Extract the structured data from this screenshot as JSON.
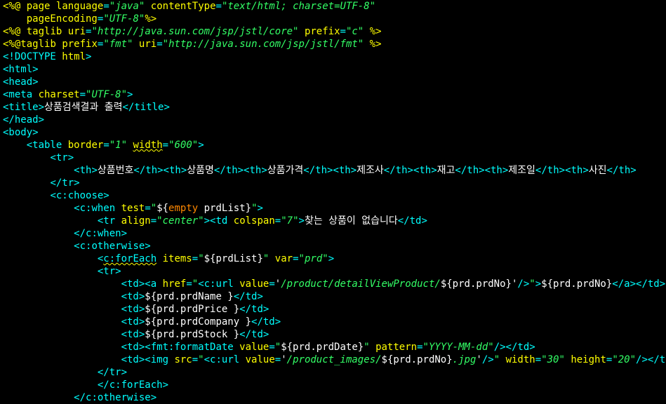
{
  "editor": {
    "colors": {
      "background": "#000000",
      "jsp_delimiter": "#ffff00",
      "tag": "#00ffff",
      "attribute": "#ffff00",
      "string": "#33ff66",
      "keyword": "#ff8800",
      "text": "#ffffff"
    },
    "lines": [
      [
        [
          "j",
          "<%@"
        ],
        [
          "x",
          " "
        ],
        [
          "a",
          "page"
        ],
        [
          "x",
          " "
        ],
        [
          "a",
          "language"
        ],
        [
          "t",
          "="
        ],
        [
          "s",
          "\"java\""
        ],
        [
          "x",
          " "
        ],
        [
          "a",
          "contentType"
        ],
        [
          "t",
          "="
        ],
        [
          "s",
          "\"text/html; charset=UTF-8\""
        ]
      ],
      [
        [
          "x",
          "    "
        ],
        [
          "a",
          "pageEncoding"
        ],
        [
          "t",
          "="
        ],
        [
          "s",
          "\"UTF-8\""
        ],
        [
          "j",
          "%>"
        ]
      ],
      [
        [
          "j",
          "<%@"
        ],
        [
          "x",
          " "
        ],
        [
          "a",
          "taglib"
        ],
        [
          "x",
          " "
        ],
        [
          "a",
          "uri"
        ],
        [
          "t",
          "="
        ],
        [
          "s",
          "\"http://java.sun.com/jsp/jstl/core\""
        ],
        [
          "x",
          " "
        ],
        [
          "a",
          "prefix"
        ],
        [
          "t",
          "="
        ],
        [
          "s",
          "\"c\""
        ],
        [
          "x",
          " "
        ],
        [
          "j",
          "%>"
        ]
      ],
      [
        [
          "j",
          "<%@"
        ],
        [
          "a",
          "taglib"
        ],
        [
          "x",
          " "
        ],
        [
          "a",
          "prefix"
        ],
        [
          "t",
          "="
        ],
        [
          "s",
          "\"fmt\""
        ],
        [
          "x",
          " "
        ],
        [
          "a",
          "uri"
        ],
        [
          "t",
          "="
        ],
        [
          "s",
          "\"http://java.sun.com/jsp/jstl/fmt\""
        ],
        [
          "x",
          " "
        ],
        [
          "j",
          "%>"
        ]
      ],
      [
        [
          "t",
          "<!DOCTYPE "
        ],
        [
          "a",
          "html"
        ],
        [
          "t",
          ">"
        ]
      ],
      [
        [
          "t",
          "<html>"
        ]
      ],
      [
        [
          "t",
          "<head>"
        ]
      ],
      [
        [
          "t",
          "<meta "
        ],
        [
          "a",
          "charset"
        ],
        [
          "t",
          "="
        ],
        [
          "s",
          "\"UTF-8\""
        ],
        [
          "t",
          ">"
        ]
      ],
      [
        [
          "t",
          "<title>"
        ],
        [
          "x",
          "상품검색결과 출력"
        ],
        [
          "t",
          "</title>"
        ]
      ],
      [
        [
          "t",
          "</head>"
        ]
      ],
      [
        [
          "t",
          "<body>"
        ]
      ],
      [
        [
          "x",
          "    "
        ],
        [
          "t",
          "<table "
        ],
        [
          "a",
          "border"
        ],
        [
          "t",
          "="
        ],
        [
          "s",
          "\"1\""
        ],
        [
          "x",
          " "
        ],
        [
          "a",
          "width",
          "squig"
        ],
        [
          "t",
          "="
        ],
        [
          "s",
          "\"600\""
        ],
        [
          "t",
          ">"
        ]
      ],
      [
        [
          "x",
          "        "
        ],
        [
          "t",
          "<tr>"
        ]
      ],
      [
        [
          "x",
          "            "
        ],
        [
          "t",
          "<th>"
        ],
        [
          "x",
          "상품번호"
        ],
        [
          "t",
          "</th><th>"
        ],
        [
          "x",
          "상품명"
        ],
        [
          "t",
          "</th><th>"
        ],
        [
          "x",
          "상품가격"
        ],
        [
          "t",
          "</th><th>"
        ],
        [
          "x",
          "제조사"
        ],
        [
          "t",
          "</th><th>"
        ],
        [
          "x",
          "재고"
        ],
        [
          "t",
          "</th><th>"
        ],
        [
          "x",
          "제조일"
        ],
        [
          "t",
          "</th><th>"
        ],
        [
          "x",
          "사진"
        ],
        [
          "t",
          "</th>"
        ]
      ],
      [
        [
          "x",
          "        "
        ],
        [
          "t",
          "</tr>"
        ]
      ],
      [
        [
          "x",
          "        "
        ],
        [
          "t",
          "<c:choose>"
        ]
      ],
      [
        [
          "x",
          "            "
        ],
        [
          "t",
          "<c:when "
        ],
        [
          "a",
          "test"
        ],
        [
          "t",
          "="
        ],
        [
          "s",
          "\""
        ],
        [
          "x",
          "${"
        ],
        [
          "k",
          "empty"
        ],
        [
          "x",
          " prdList}"
        ],
        [
          "s",
          "\""
        ],
        [
          "t",
          ">"
        ]
      ],
      [
        [
          "x",
          "                "
        ],
        [
          "t",
          "<tr "
        ],
        [
          "a",
          "align"
        ],
        [
          "t",
          "="
        ],
        [
          "s",
          "\"center\""
        ],
        [
          "t",
          "><td "
        ],
        [
          "a",
          "colspan"
        ],
        [
          "t",
          "="
        ],
        [
          "s",
          "\"7\""
        ],
        [
          "t",
          ">"
        ],
        [
          "x",
          "찾는 상품이 없습니다"
        ],
        [
          "t",
          "</td>"
        ]
      ],
      [
        [
          "x",
          "            "
        ],
        [
          "t",
          "</c:when>"
        ]
      ],
      [
        [
          "x",
          "            "
        ],
        [
          "t",
          "<c:otherwise>"
        ]
      ],
      [
        [
          "x",
          "                "
        ],
        [
          "t",
          "<"
        ],
        [
          "t",
          "c:forEach",
          "squig"
        ],
        [
          "x",
          " "
        ],
        [
          "a",
          "items"
        ],
        [
          "t",
          "="
        ],
        [
          "s",
          "\""
        ],
        [
          "x",
          "${prdList}"
        ],
        [
          "s",
          "\""
        ],
        [
          "x",
          " "
        ],
        [
          "a",
          "var"
        ],
        [
          "t",
          "="
        ],
        [
          "s",
          "\"prd\""
        ],
        [
          "t",
          ">"
        ]
      ],
      [
        [
          "x",
          "                "
        ],
        [
          "t",
          "<tr>"
        ]
      ],
      [
        [
          "x",
          "                    "
        ],
        [
          "t",
          "<td><a "
        ],
        [
          "a",
          "href"
        ],
        [
          "t",
          "="
        ],
        [
          "s",
          "\""
        ],
        [
          "t",
          "<c:url "
        ],
        [
          "a",
          "value"
        ],
        [
          "t",
          "="
        ],
        [
          "q",
          "'"
        ],
        [
          "s",
          "/product/detailViewProduct/"
        ],
        [
          "x",
          "${prd.prdNo}"
        ],
        [
          "q",
          "'"
        ],
        [
          "t",
          "/>"
        ],
        [
          "s",
          "\""
        ],
        [
          "t",
          ">"
        ],
        [
          "x",
          "${prd.prdNo}"
        ],
        [
          "t",
          "</a></td>"
        ]
      ],
      [
        [
          "x",
          "                    "
        ],
        [
          "t",
          "<td>"
        ],
        [
          "x",
          "${prd.prdName }"
        ],
        [
          "t",
          "</td>"
        ]
      ],
      [
        [
          "x",
          "                    "
        ],
        [
          "t",
          "<td>"
        ],
        [
          "x",
          "${prd.prdPrice }"
        ],
        [
          "t",
          "</td>"
        ]
      ],
      [
        [
          "x",
          "                    "
        ],
        [
          "t",
          "<td>"
        ],
        [
          "x",
          "${prd.prdCompany }"
        ],
        [
          "t",
          "</td>"
        ]
      ],
      [
        [
          "x",
          "                    "
        ],
        [
          "t",
          "<td>"
        ],
        [
          "x",
          "${prd.prdStock }"
        ],
        [
          "t",
          "</td>"
        ]
      ],
      [
        [
          "x",
          "                    "
        ],
        [
          "t",
          "<td><fmt:formatDate "
        ],
        [
          "a",
          "value"
        ],
        [
          "t",
          "="
        ],
        [
          "s",
          "\""
        ],
        [
          "x",
          "${prd.prdDate}"
        ],
        [
          "s",
          "\""
        ],
        [
          "x",
          " "
        ],
        [
          "a",
          "pattern"
        ],
        [
          "t",
          "="
        ],
        [
          "s",
          "\"YYYY-MM-dd\""
        ],
        [
          "t",
          "/></td>"
        ]
      ],
      [
        [
          "x",
          "                    "
        ],
        [
          "t",
          "<td><img "
        ],
        [
          "a",
          "src"
        ],
        [
          "t",
          "="
        ],
        [
          "s",
          "\""
        ],
        [
          "t",
          "<c:url "
        ],
        [
          "a",
          "value"
        ],
        [
          "t",
          "="
        ],
        [
          "q",
          "'"
        ],
        [
          "s",
          "/product_images/"
        ],
        [
          "x",
          "${prd.prdNo}"
        ],
        [
          "s",
          ".jpg"
        ],
        [
          "q",
          "'"
        ],
        [
          "t",
          "/>"
        ],
        [
          "s",
          "\""
        ],
        [
          "x",
          " "
        ],
        [
          "a",
          "width"
        ],
        [
          "t",
          "="
        ],
        [
          "s",
          "\"30\""
        ],
        [
          "x",
          " "
        ],
        [
          "a",
          "height"
        ],
        [
          "t",
          "="
        ],
        [
          "s",
          "\"20\""
        ],
        [
          "t",
          "/></td>"
        ]
      ],
      [
        [
          "x",
          "                "
        ],
        [
          "t",
          "</tr>"
        ]
      ],
      [
        [
          "x",
          "                "
        ],
        [
          "t",
          "</c:forEach>"
        ]
      ],
      [
        [
          "x",
          "            "
        ],
        [
          "t",
          "</c:otherwise>"
        ]
      ]
    ]
  }
}
